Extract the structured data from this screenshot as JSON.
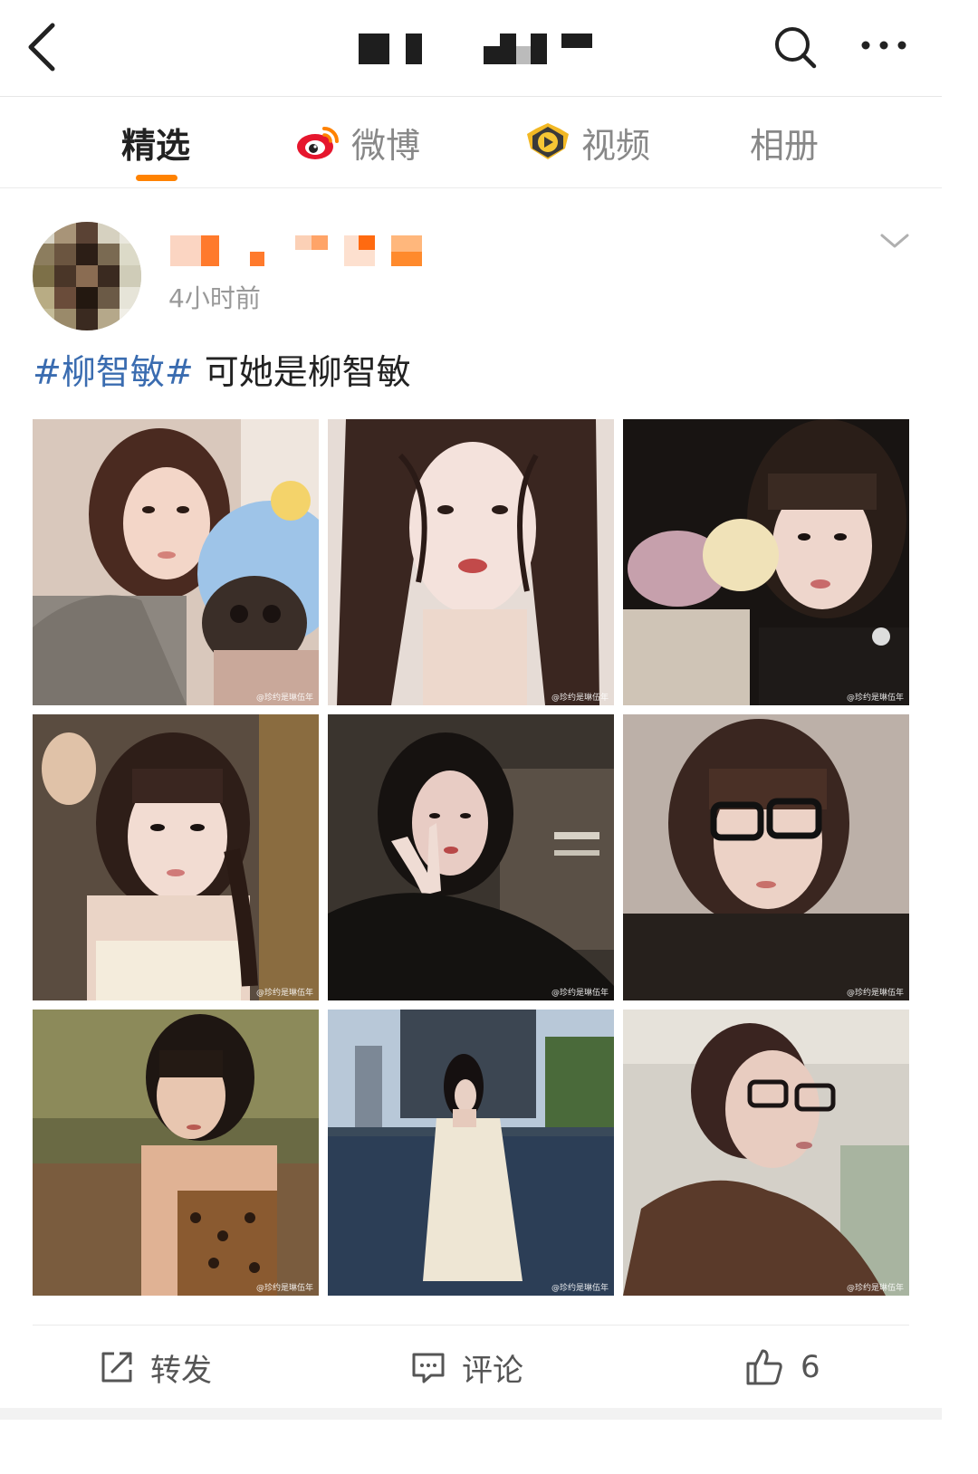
{
  "header": {
    "back_icon": "chevron-left-icon",
    "search_icon": "search-icon",
    "more_icon": "more-horizontal-icon"
  },
  "tabs": [
    {
      "label": "精选",
      "active": true
    },
    {
      "label": "微博",
      "icon": "weibo-logo-icon"
    },
    {
      "label": "视频",
      "icon": "video-badge-icon"
    },
    {
      "label": "相册"
    }
  ],
  "post": {
    "time": "4小时前",
    "hashtag": "#柳智敏#",
    "text": " 可她是柳智敏",
    "watermark": "@珍约是琳伍年",
    "photos_count": 9
  },
  "actions": {
    "repost": "转发",
    "comment": "评论",
    "like_count": "6"
  },
  "colors": {
    "accent": "#ff8200",
    "hashtag": "#3a6cb0"
  }
}
